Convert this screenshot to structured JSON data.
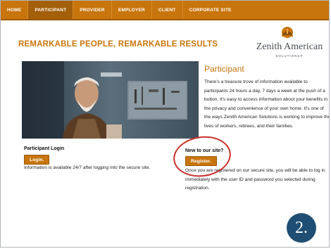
{
  "nav": {
    "items": [
      {
        "label": "HOME"
      },
      {
        "label": "PARTICIPANT"
      },
      {
        "label": "PROVIDER"
      },
      {
        "label": "EMPLOYER"
      },
      {
        "label": "CLIENT"
      },
      {
        "label": "CORPORATE SITE"
      }
    ],
    "active_index": 1
  },
  "headline": "REMARKABLE PEOPLE, REMARKABLE RESULTS",
  "logo": {
    "name": "Zenith American",
    "tagline": "SOLUTIONS®"
  },
  "participant": {
    "title": "Participant",
    "body": "There's a treasure trove of information available to participants 24 hours a day, 7 days a week at the push of a button. It's easy to access information about your benefits in the privacy and convenience of your own home. It's one of the ways Zenith American Solutions is working to improve the lives of workers, retirees, and their families."
  },
  "login": {
    "title": "Participant Login",
    "button": "Login.",
    "info": "Information is available 24/7 after logging into the secure site."
  },
  "register": {
    "title": "New to our site?",
    "button": "Register.",
    "info": "Once you are registered on our secure site, you will be able to log in immediately with the user ID and password you selected during registration."
  },
  "step_badge": "2.",
  "colors": {
    "brand": "#c8750d",
    "annotation": "#c9302c",
    "badge": "#1e4e73"
  },
  "icons": {
    "logo_mark": "hard-hat-icon"
  }
}
